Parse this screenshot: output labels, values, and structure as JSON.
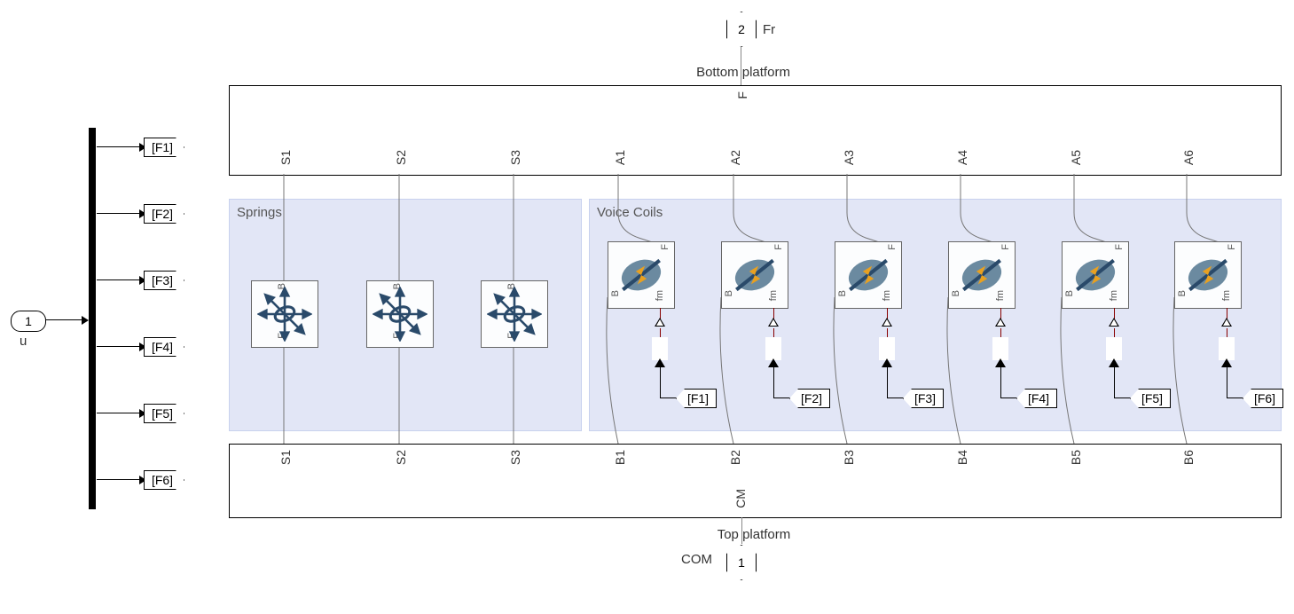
{
  "input": {
    "port_number": "1",
    "name": "u"
  },
  "demux_tags": [
    "[F1]",
    "[F2]",
    "[F3]",
    "[F4]",
    "[F5]",
    "[F6]"
  ],
  "top_platform": {
    "title": "Bottom platform",
    "ext_port_label": "Fr",
    "ext_port_number": "2",
    "center_port": "F",
    "ports": [
      "S1",
      "S2",
      "S3",
      "A1",
      "A2",
      "A3",
      "A4",
      "A5",
      "A6"
    ]
  },
  "springs_group": {
    "title": "Springs",
    "blocks": [
      {
        "top": "B",
        "bottom": "F"
      },
      {
        "top": "B",
        "bottom": "F"
      },
      {
        "top": "B",
        "bottom": "F"
      }
    ]
  },
  "coils_group": {
    "title": "Voice Coils",
    "blocks": [
      {
        "top": "F",
        "left": "B",
        "bottom": "fm",
        "tag": "[F1]"
      },
      {
        "top": "F",
        "left": "B",
        "bottom": "fm",
        "tag": "[F2]"
      },
      {
        "top": "F",
        "left": "B",
        "bottom": "fm",
        "tag": "[F3]"
      },
      {
        "top": "F",
        "left": "B",
        "bottom": "fm",
        "tag": "[F4]"
      },
      {
        "top": "F",
        "left": "B",
        "bottom": "fm",
        "tag": "[F5]"
      },
      {
        "top": "F",
        "left": "B",
        "bottom": "fm",
        "tag": "[F6]"
      }
    ]
  },
  "bottom_platform": {
    "title": "Top platform",
    "center_port": "CM",
    "ext_label": "COM",
    "ext_port_number": "1",
    "ports": [
      "S1",
      "S2",
      "S3",
      "B1",
      "B2",
      "B3",
      "B4",
      "B5",
      "B6"
    ]
  }
}
